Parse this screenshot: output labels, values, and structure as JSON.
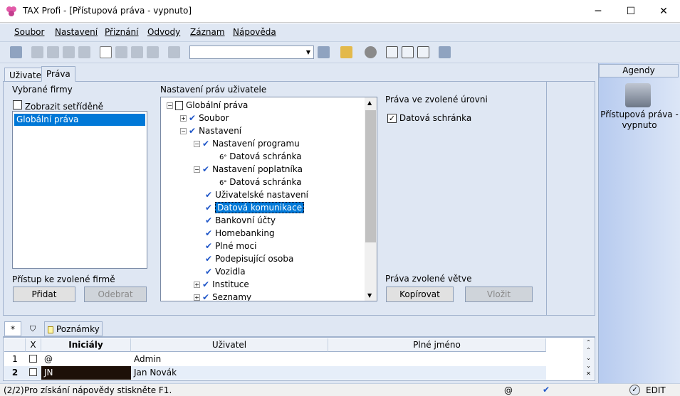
{
  "window": {
    "title": "TAX Profi - [Přístupová práva - vypnuto]",
    "min": "─",
    "max": "☐",
    "close": "✕"
  },
  "menu": [
    "Soubor",
    "Nastavení",
    "Přiznání",
    "Odvody",
    "Záznam",
    "Nápověda"
  ],
  "tabs": [
    "Uživatel",
    "Práva"
  ],
  "left": {
    "title": "Vybrané firmy",
    "sort_label": "Zobrazit setříděně",
    "selected": "Globální práva",
    "access_label": "Přístup ke zvolené firmě",
    "add": "Přidat",
    "remove": "Odebrat"
  },
  "tree": {
    "title": "Nastavení práv uživatele",
    "nodes": [
      {
        "label": "Globální práva"
      },
      {
        "label": "Soubor"
      },
      {
        "label": "Nastavení"
      },
      {
        "label": "Nastavení programu"
      },
      {
        "label": "Datová schránka"
      },
      {
        "label": "Nastavení poplatníka"
      },
      {
        "label": "Datová schránka"
      },
      {
        "label": "Uživatelské nastavení"
      },
      {
        "label": "Datová komunikace"
      },
      {
        "label": "Bankovní účty"
      },
      {
        "label": "Homebanking"
      },
      {
        "label": "Plné moci"
      },
      {
        "label": "Podepisující osoba"
      },
      {
        "label": "Vozidla"
      },
      {
        "label": "Instituce"
      },
      {
        "label": "Seznamy"
      }
    ]
  },
  "right": {
    "title": "Práva ve zvolené úrovni",
    "check_label": "Datová schránka",
    "branch_label": "Práva zvolené větve",
    "copy": "Kopírovat",
    "paste": "Vložit"
  },
  "grid_tabs": {
    "star": "*",
    "notes": "Poznámky"
  },
  "grid": {
    "headers": [
      "X",
      "Iniciály",
      "Uživatel",
      "Plné jméno"
    ],
    "rows": [
      {
        "num": "1",
        "initials": "@",
        "user": "Admin",
        "full": ""
      },
      {
        "num": "2",
        "initials": "JN",
        "user": "Jan Novák",
        "full": ""
      }
    ]
  },
  "agendy": {
    "title": "Agendy",
    "item": "Přístupová práva - vypnuto"
  },
  "status": {
    "page": "(2/2)",
    "help": "Pro získání nápovědy stiskněte F1.",
    "at": "@",
    "mode": "EDIT"
  }
}
